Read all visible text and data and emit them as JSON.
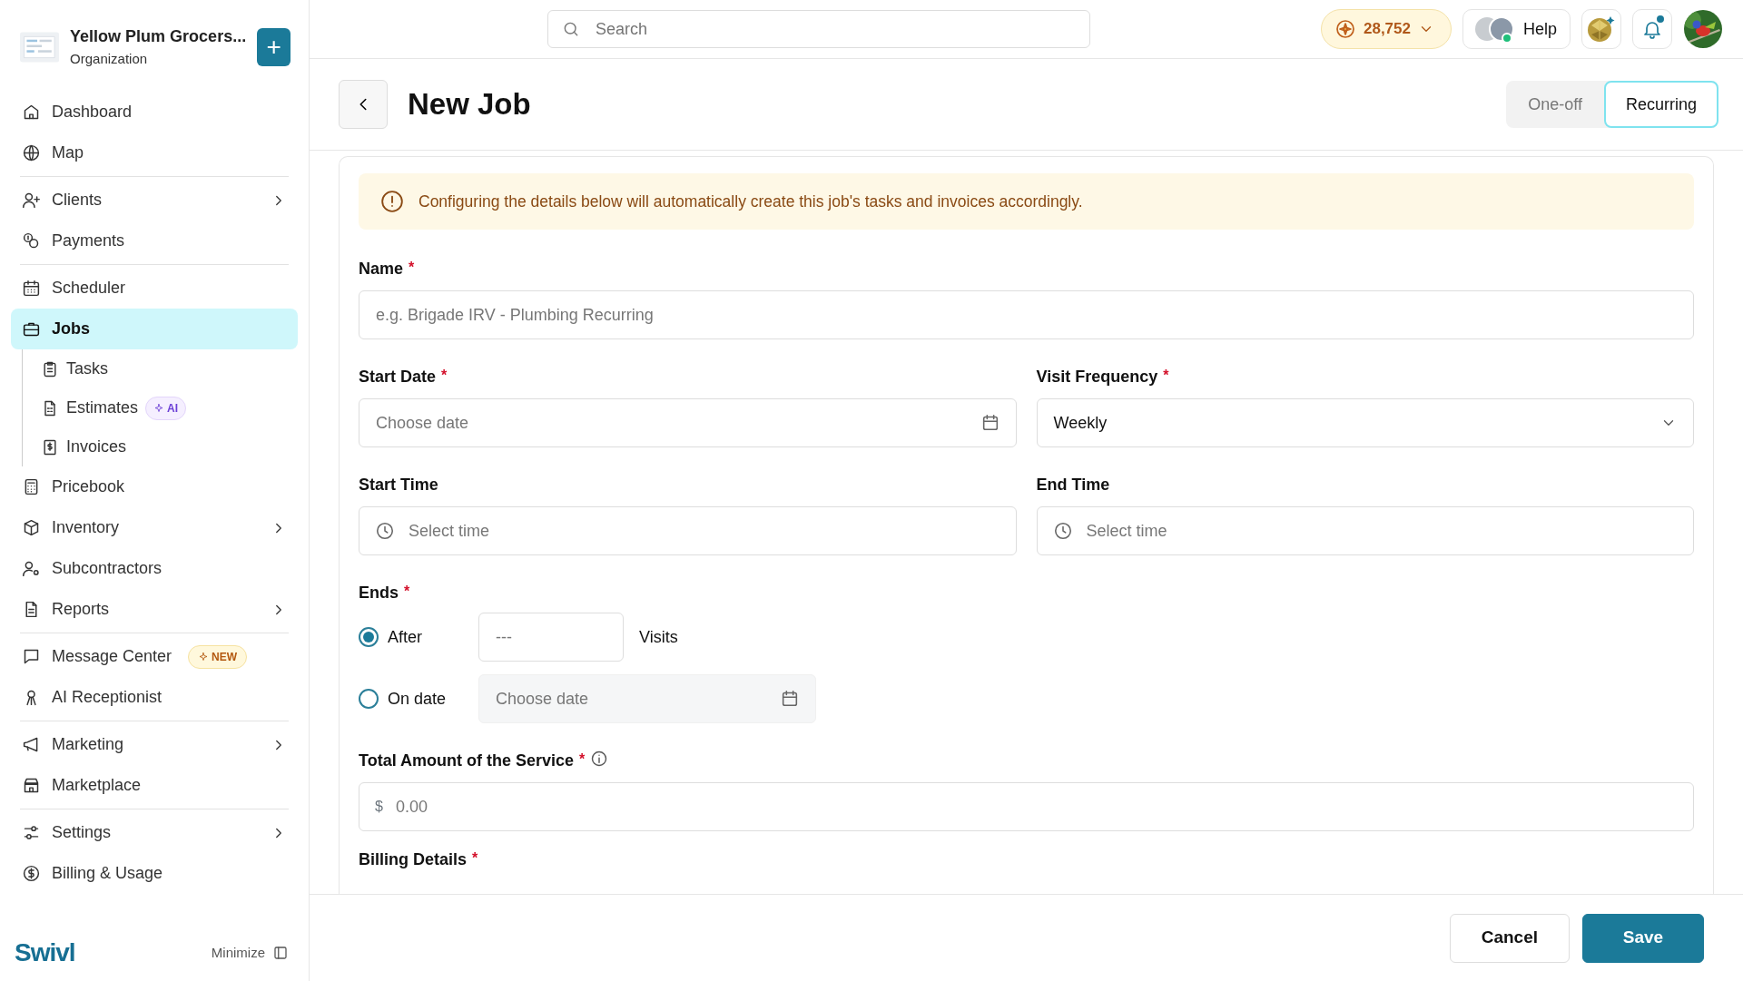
{
  "organization": {
    "name": "Yellow Plum Grocers...",
    "subtitle": "Organization",
    "add_button": "+"
  },
  "sidebar": {
    "groups": [
      [
        {
          "label": "Dashboard",
          "expandable": false,
          "selected": false
        },
        {
          "label": "Map",
          "expandable": false,
          "selected": false
        }
      ],
      [
        {
          "label": "Clients",
          "expandable": true,
          "selected": false
        },
        {
          "label": "Payments",
          "expandable": false,
          "selected": false
        }
      ],
      [
        {
          "label": "Scheduler",
          "expandable": false,
          "selected": false
        },
        {
          "label": "Jobs",
          "expandable": false,
          "selected": true,
          "children": [
            {
              "label": "Tasks",
              "selected": false
            },
            {
              "label": "Estimates",
              "selected": false,
              "badge": {
                "label": "AI",
                "kind": "ai"
              }
            },
            {
              "label": "Invoices",
              "selected": false
            }
          ]
        },
        {
          "label": "Pricebook",
          "expandable": false,
          "selected": false
        },
        {
          "label": "Inventory",
          "expandable": true,
          "selected": false
        },
        {
          "label": "Subcontractors",
          "expandable": false,
          "selected": false
        },
        {
          "label": "Reports",
          "expandable": true,
          "selected": false
        }
      ],
      [
        {
          "label": "Message Center",
          "expandable": false,
          "selected": false,
          "badge": {
            "label": "NEW",
            "kind": "new"
          }
        },
        {
          "label": "AI Receptionist",
          "expandable": false,
          "selected": false
        }
      ],
      [
        {
          "label": "Marketing",
          "expandable": true,
          "selected": false
        },
        {
          "label": "Marketplace",
          "expandable": false,
          "selected": false
        }
      ],
      [
        {
          "label": "Settings",
          "expandable": true,
          "selected": false
        },
        {
          "label": "Billing & Usage",
          "expandable": false,
          "selected": false
        }
      ]
    ],
    "logo": "Swivl",
    "minimize": "Minimize"
  },
  "topbar": {
    "search": {
      "placeholder": "Search"
    },
    "points": "28,752",
    "help": "Help",
    "notifications_unread": true
  },
  "page": {
    "title": "New Job",
    "tabs": [
      {
        "label": "One-off",
        "selected": false
      },
      {
        "label": "Recurring",
        "selected": true
      }
    ]
  },
  "notice": "Configuring the details below will automatically create this job's tasks and invoices accordingly.",
  "form": {
    "name": {
      "label": "Name",
      "required_mark": "*",
      "placeholder": "e.g. Brigade IRV - Plumbing Recurring"
    },
    "start_date": {
      "label": "Start Date",
      "required_mark": "*",
      "placeholder": "Choose date"
    },
    "visit_frequency": {
      "label": "Visit Frequency",
      "required_mark": "*",
      "value": "Weekly"
    },
    "start_time": {
      "label": "Start Time",
      "placeholder": "Select time"
    },
    "end_time": {
      "label": "End Time",
      "placeholder": "Select time"
    },
    "ends": {
      "label": "Ends",
      "required_mark": "*",
      "options": [
        {
          "label": "After",
          "kind": "count",
          "selected": true,
          "placeholder": "---",
          "suffix": "Visits"
        },
        {
          "label": "On date",
          "kind": "date",
          "selected": false,
          "placeholder": "Choose date"
        }
      ]
    },
    "total_amount": {
      "label": "Total Amount of the Service",
      "required_mark": "*",
      "currency": "$",
      "placeholder": "0.00"
    },
    "billing_details": {
      "label": "Billing Details",
      "required_mark": "*"
    }
  },
  "actions": [
    {
      "label": "Cancel",
      "kind": "secondary"
    },
    {
      "label": "Save",
      "kind": "primary"
    }
  ]
}
